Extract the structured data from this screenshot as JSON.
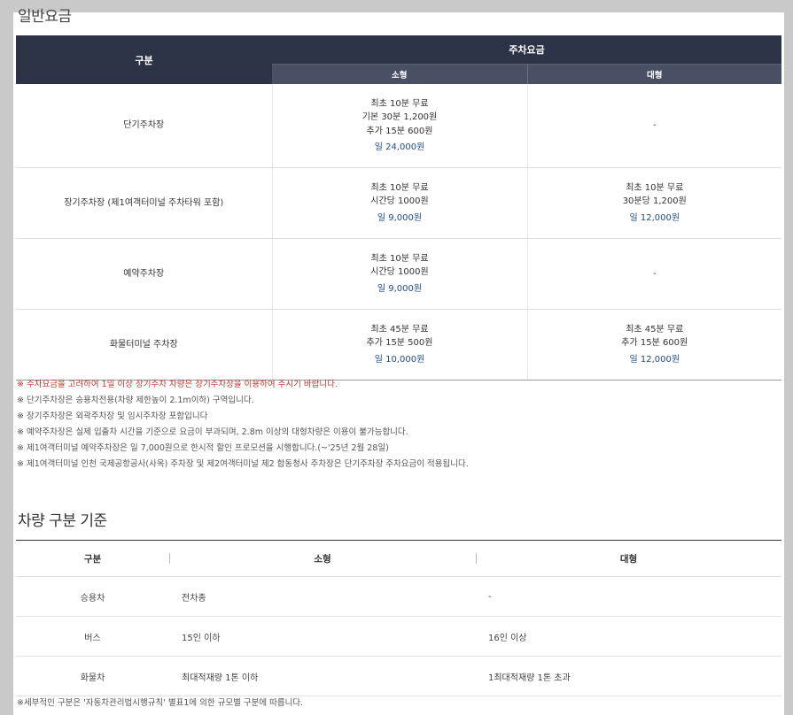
{
  "general": {
    "title": "일반요금",
    "header": {
      "category": "구분",
      "fee": "주차요금",
      "small": "소형",
      "large": "대형"
    },
    "rows": [
      {
        "name": "단기주차장",
        "small": {
          "lines": [
            "최초 10분 무료",
            "기본 30분 1,200원",
            "추가 15분 600원"
          ],
          "day": "일 24,000원"
        },
        "large": {
          "lines": [
            "-"
          ],
          "day": ""
        }
      },
      {
        "name": "장기주차장 (제1여객터미널 주차타워 포함)",
        "small": {
          "lines": [
            "최초 10분 무료",
            "시간당 1000원"
          ],
          "day": "일 9,000원"
        },
        "large": {
          "lines": [
            "최초 10분 무료",
            "30분당 1,200원"
          ],
          "day": "일 12,000원"
        }
      },
      {
        "name": "예약주차장",
        "small": {
          "lines": [
            "최초 10분 무료",
            "시간당 1000원"
          ],
          "day": "일 9,000원"
        },
        "large": {
          "lines": [
            "-"
          ],
          "day": ""
        }
      },
      {
        "name": "화물터미널 주차장",
        "small": {
          "lines": [
            "최초 45분 무료",
            "추가 15분 500원"
          ],
          "day": "일 10,000원"
        },
        "large": {
          "lines": [
            "최초 45분 무료",
            "추가 15분 600원"
          ],
          "day": "일 12,000원"
        }
      }
    ]
  },
  "notes": [
    {
      "text": "※ 주차요금을 고려하여 1일 이상 장기주차 차량은 장기주차장을 이용하여 주시기 바랍니다.",
      "highlight": true
    },
    {
      "text": "※ 단기주차장은 승용차전용(차량 제한높이 2.1m이하) 구역입니다.",
      "highlight": false
    },
    {
      "text": "※ 장기주차장은 외곽주차장 및 임시주차장 포함입니다",
      "highlight": false
    },
    {
      "text": "※ 예약주차장은 실제 입출차 시간을 기준으로 요금이 부과되며, 2.8m 이상의 대형차량은 이용이 불가능합니다.",
      "highlight": false
    },
    {
      "text": "※ 제1여객터미널 예약주차장은 일 7,000원으로 한시적 할인 프로모션을 시행합니다.(~'25년 2월 28일)",
      "highlight": false
    },
    {
      "text": "※ 제1여객터미널 인천 국제공항공사(사옥) 주차장 및 제2여객터미널 제2 합동청사 주차장은 단기주차장 주차요금이 적용됩니다.",
      "highlight": false
    }
  ],
  "vehicle": {
    "title": "차량 구분 기준",
    "header": {
      "category": "구분",
      "small": "소형",
      "large": "대형"
    },
    "rows": [
      {
        "type": "승용차",
        "small": "전차종",
        "large": "-"
      },
      {
        "type": "버스",
        "small": "15인 이하",
        "large": "16인 이상"
      },
      {
        "type": "화물차",
        "small": "최대적재량 1톤 이하",
        "large": "1최대적재량 1톤 초과"
      }
    ],
    "footnote": "※세부적인 구분은 '자동차관리법시행규칙' 별표1에 의한 규모별 구분에 따릅니다."
  },
  "colors": {
    "header_dark": "#2d3346",
    "header_sub": "#4a5064",
    "day_rate": "#234c88",
    "highlight_note": "#c3352a",
    "page_background": "#c9c9c9"
  }
}
